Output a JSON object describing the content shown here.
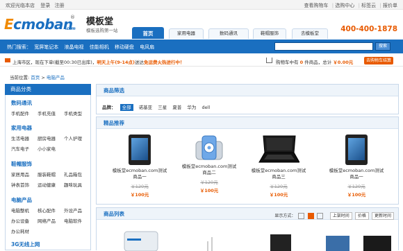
{
  "topbar": {
    "welcome": "欢迎光临本店",
    "login": "登录",
    "register": "注册",
    "links": [
      "查看购物车",
      "选购中心",
      "标签云",
      "报价单"
    ]
  },
  "header": {
    "logo_e": "E",
    "logo_rest": "cmoban",
    "logo_com": ".com",
    "logo_reg": "®",
    "brand": "模板堂",
    "brand_sub": "模板选购第一站",
    "hotline": "400-400-1878",
    "nav": [
      "首页",
      "家用电器",
      "数码通讯",
      "鞋帽服饰",
      "去模板堂"
    ]
  },
  "search": {
    "hot_label": "热门搜索：",
    "hot_items": [
      "宽屏笔记本",
      "液晶电视",
      "佳能相机",
      "移动硬盘",
      "电风扇"
    ],
    "button": "搜索"
  },
  "delivery": {
    "prefix": "上海市区，现在下单(截至00:30已出库)，",
    "date": "明天上午(9-14点)",
    "mid": "送达",
    "free": "免运费火热进行中！",
    "cart_prefix": "购物车中有",
    "cart_count": "0",
    "cart_mid": "件商品，总计",
    "cart_total": "￥0.00元",
    "settle": "去购物车结算"
  },
  "breadcrumb": {
    "label": "当前位置:",
    "home": "首页",
    "sep": ">",
    "current": "电脑产品"
  },
  "sidebar": {
    "title": "商品分类",
    "categories": [
      {
        "title": "数码通讯",
        "items": [
          "手机配件",
          "手机充值",
          "手机类型"
        ]
      },
      {
        "title": "家用电器",
        "items": [
          "生活电器",
          "厨房电器",
          "个人护理",
          "汽车电子",
          "小小家电"
        ]
      },
      {
        "title": "鞋帽服饰",
        "items": [
          "家居用品",
          "服装鞋帽",
          "礼品箱包",
          "钟表首饰",
          "运动健康",
          "趣味玩具"
        ]
      },
      {
        "title": "电脑产品",
        "items": [
          "电脑整机",
          "核心配件",
          "外设产品",
          "办公设备",
          "网络产品",
          "电脑软件",
          "办公耗材"
        ]
      },
      {
        "title": "3G无线上网",
        "items": []
      }
    ]
  },
  "filter": {
    "title": "商品筛选",
    "brand_label": "品牌：",
    "brands": [
      "全部",
      "诺基亚",
      "三星",
      "夏普",
      "华为",
      "dell"
    ]
  },
  "recommend": {
    "title": "精品推荐",
    "products": [
      {
        "name": "模板堂ecmoban.com测试商品一",
        "old": "￥120元",
        "price": "￥100元"
      },
      {
        "name": "模板堂ecmoban.com测试商品二",
        "old": "￥120元",
        "price": "￥100元"
      },
      {
        "name": "模板堂ecmoban.com测试商品三",
        "old": "￥120元",
        "price": "￥100元"
      },
      {
        "name": "模板堂ecmoban.com测试商品一",
        "old": "￥120元",
        "price": "￥100元"
      }
    ]
  },
  "list": {
    "title": "商品列表",
    "display_label": "显示方式：",
    "sort": [
      "上架时间",
      "价格",
      "更新时间"
    ]
  }
}
